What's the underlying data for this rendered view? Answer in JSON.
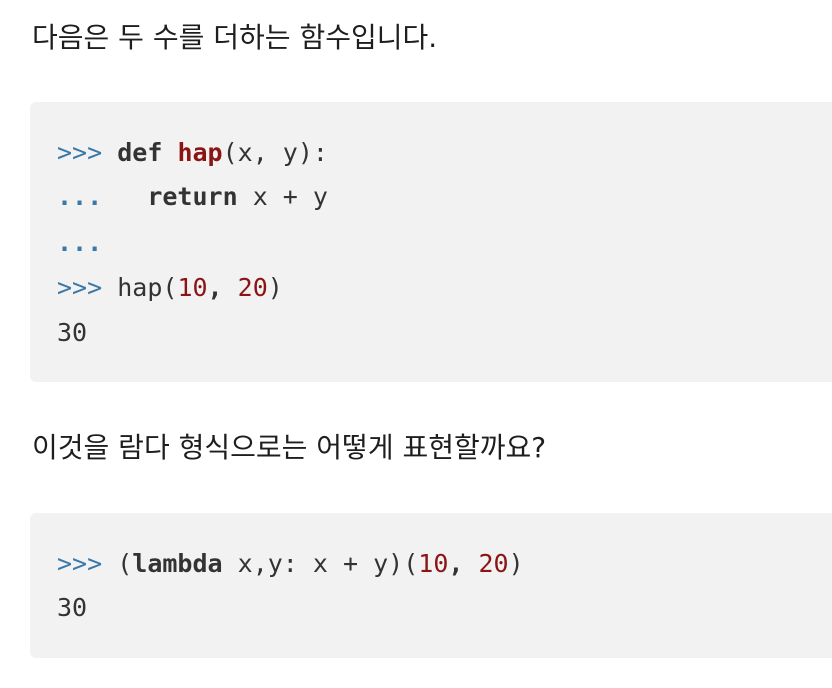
{
  "paragraphs": {
    "intro": "다음은 두 수를 더하는 함수입니다.",
    "question": "이것을 람다 형식으로는 어떻게 표현할까요?"
  },
  "code_block_1": {
    "line1": {
      "prompt": ">>>",
      "kw": "def",
      "fn": "hap",
      "rest": "(x, y):"
    },
    "line2": {
      "prompt": "...",
      "kw": "return",
      "rest": "x + y"
    },
    "line3": {
      "prompt": "..."
    },
    "line4": {
      "prompt": ">>>",
      "call": "hap(",
      "arg1": "10",
      "sep": ", ",
      "arg2": "20",
      "close": ")"
    },
    "line5": {
      "output": "30"
    }
  },
  "code_block_2": {
    "line1": {
      "prompt": ">>>",
      "open": "(",
      "kw": "lambda",
      "rest": "x,y: x + y)(",
      "arg1": "10",
      "sep": ", ",
      "arg2": "20",
      "close": ")"
    },
    "line2": {
      "output": "30"
    }
  }
}
